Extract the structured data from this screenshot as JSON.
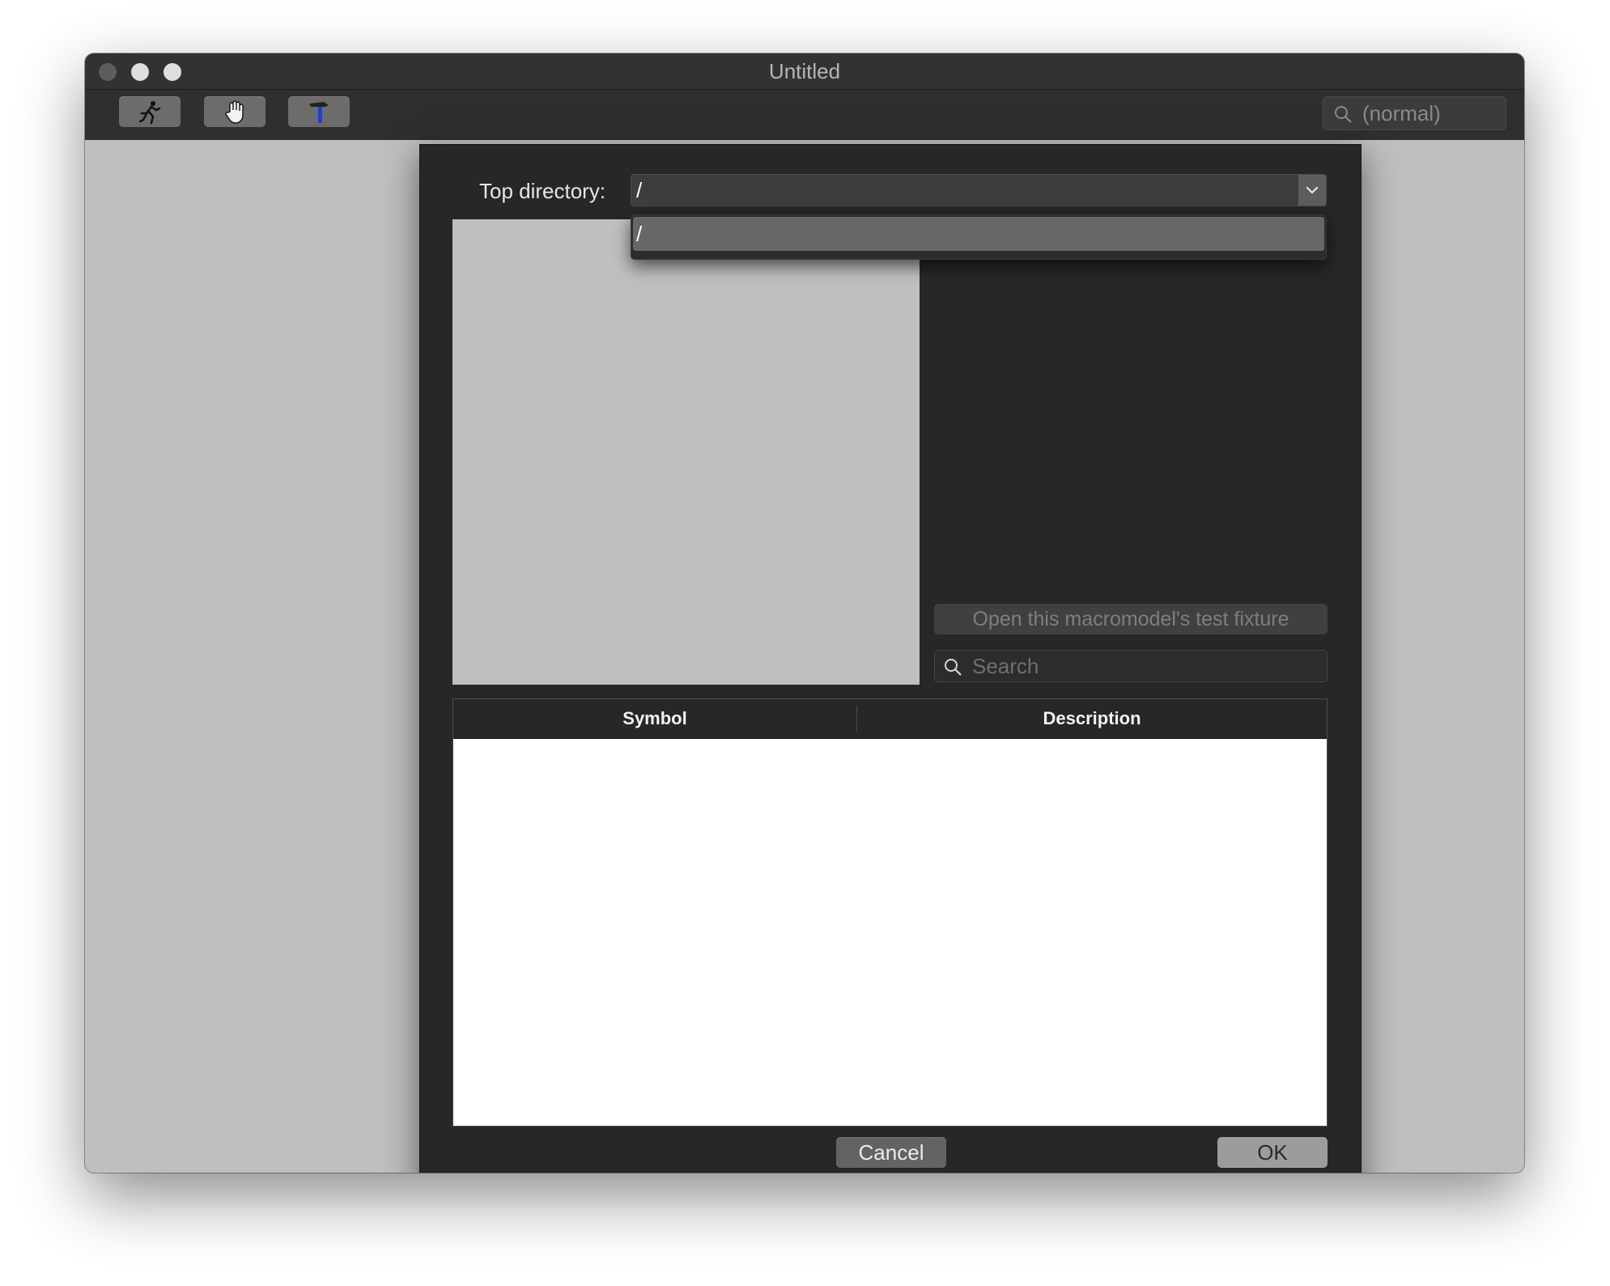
{
  "window": {
    "title": "Untitled"
  },
  "toolbar": {
    "buttons": [
      {
        "name": "run",
        "icon": "running-man-icon"
      },
      {
        "name": "hand",
        "icon": "hand-icon"
      },
      {
        "name": "build",
        "icon": "hammer-icon"
      }
    ],
    "search_text": "(normal)"
  },
  "dialog": {
    "top_directory_label": "Top directory:",
    "top_directory_value": "/",
    "dropdown_options": [
      "/"
    ],
    "fixture_button_label": "Open this macromodel's test fixture",
    "search_placeholder": "Search",
    "table": {
      "columns": [
        "Symbol",
        "Description"
      ],
      "rows": []
    },
    "cancel_label": "Cancel",
    "ok_label": "OK"
  },
  "colors": {
    "window_bg": "#bfbfbf",
    "dialog_bg": "#272727",
    "titlebar_bg": "#323232"
  }
}
